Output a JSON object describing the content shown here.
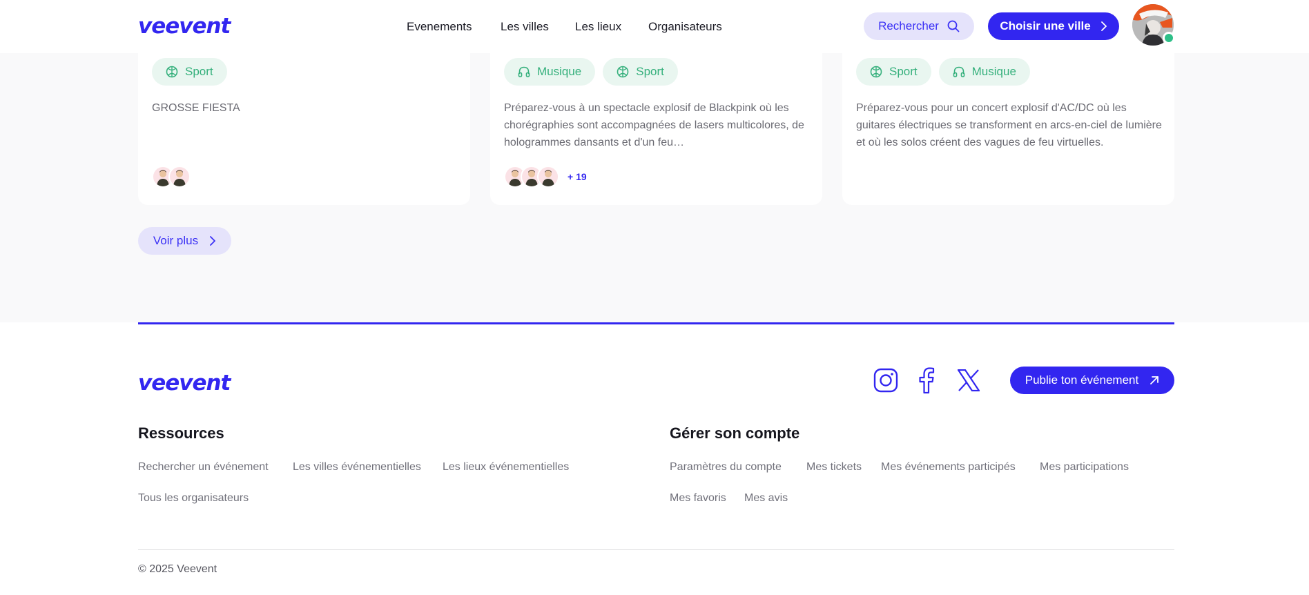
{
  "header": {
    "logo_text": "veevent",
    "nav": [
      "Evenements",
      "Les villes",
      "Les lieux",
      "Organisateurs"
    ],
    "search_label": "Rechercher",
    "city_label": "Choisir une ville"
  },
  "cards": [
    {
      "tags": [
        {
          "label": "Sport",
          "icon": "basketball-icon"
        }
      ],
      "description": "GROSSE FIESTA",
      "participant_count": 2,
      "extra": ""
    },
    {
      "tags": [
        {
          "label": "Musique",
          "icon": "headphones-icon"
        },
        {
          "label": "Sport",
          "icon": "basketball-icon"
        }
      ],
      "description": "Préparez-vous à un spectacle explosif de Blackpink où les chorégraphies sont accompagnées de lasers multicolores, de hologrammes dansants et d'un feu…",
      "participant_count": 3,
      "extra": "+ 19"
    },
    {
      "tags": [
        {
          "label": "Sport",
          "icon": "basketball-icon"
        },
        {
          "label": "Musique",
          "icon": "headphones-icon"
        }
      ],
      "description": "Préparez-vous pour un concert explosif d'AC/DC où les guitares électriques se transforment en arcs-en-ciel de lumière et où les solos créent des vagues de feu virtuelles.",
      "participant_count": 0,
      "extra": ""
    }
  ],
  "more_label": "Voir plus",
  "footer": {
    "logo_text": "veevent",
    "socials": [
      "instagram-icon",
      "facebook-icon",
      "x-icon"
    ],
    "publish_label": "Publie ton événement",
    "resources": {
      "title": "Ressources",
      "links": [
        "Rechercher un événement",
        "Les villes événementielles",
        "Les lieux événementielles",
        "Tous les organisateurs"
      ]
    },
    "account": {
      "title": "Gérer son compte",
      "links": [
        "Paramètres du compte",
        "Mes tickets",
        "Mes événements participés",
        "Mes participations",
        "Mes favoris",
        "Mes avis"
      ]
    },
    "copyright": "© 2025 Veevent"
  },
  "colors": {
    "brand": "#3226f0",
    "brand_light": "#e5e3fb",
    "tag_bg": "#e9f6f0",
    "tag_text": "#35b07c",
    "online": "#2ebf88"
  }
}
